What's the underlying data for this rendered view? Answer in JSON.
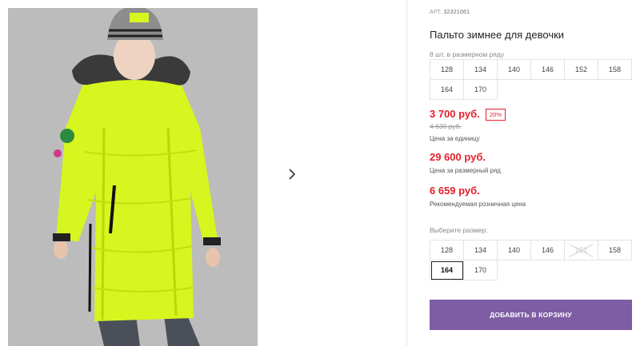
{
  "gallery": {
    "image_description": "product-photo-girl-neon-yellow-winter-coat",
    "next_icon": "chevron-right-icon"
  },
  "product": {
    "sku_label": "АРТ.",
    "sku_value": "32321061",
    "title": "Пальто зимнее для девочки"
  },
  "pack": {
    "label": "8 шт. в размерном ряду",
    "sizes": [
      "128",
      "134",
      "140",
      "146",
      "152",
      "158",
      "164",
      "170"
    ]
  },
  "pricing": {
    "price": "3 700 руб.",
    "discount": "20%",
    "old_price": "4 630 руб.",
    "unit_note": "Цена за единицу",
    "pack_price": "29 600 руб.",
    "pack_note": "Цена за размерный ряд",
    "retail_price": "6 659 руб.",
    "retail_note": "Рекомендуемая розничная цена",
    "accent_color": "#e4202b"
  },
  "size_picker": {
    "label": "Выберите размер:",
    "sizes": [
      {
        "label": "128",
        "state": "available"
      },
      {
        "label": "134",
        "state": "available"
      },
      {
        "label": "140",
        "state": "available"
      },
      {
        "label": "146",
        "state": "available"
      },
      {
        "label": "152",
        "state": "unavailable"
      },
      {
        "label": "158",
        "state": "available"
      },
      {
        "label": "164",
        "state": "selected"
      },
      {
        "label": "170",
        "state": "available"
      }
    ]
  },
  "cart": {
    "button_label": "ДОБАВИТЬ В КОРЗИНУ",
    "button_color": "#7e5da4"
  }
}
